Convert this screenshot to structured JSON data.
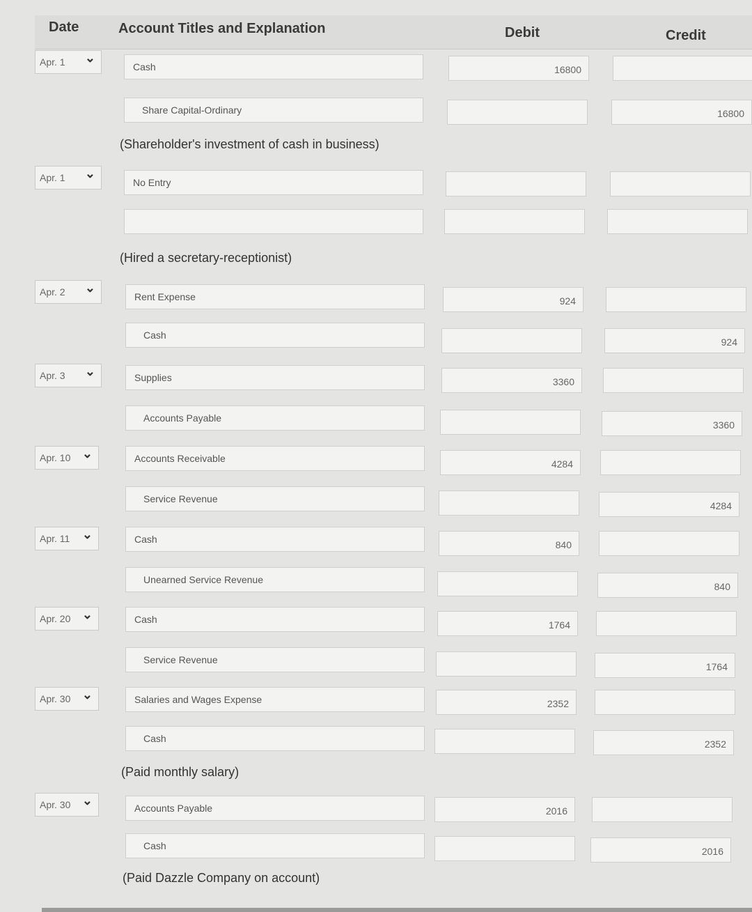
{
  "headers": {
    "date": "Date",
    "account": "Account Titles and Explanation",
    "debit": "Debit",
    "credit": "Credit"
  },
  "entries": [
    {
      "date": "Apr. 1",
      "debit_account": "Cash",
      "credit_account": "Share Capital-Ordinary",
      "debit": "16800",
      "credit": "16800",
      "explanation": "(Shareholder's investment of cash in business)"
    },
    {
      "date": "Apr. 1",
      "debit_account": "No Entry",
      "credit_account": "",
      "debit": "",
      "credit": "",
      "explanation": "(Hired a secretary-receptionist)"
    },
    {
      "date": "Apr. 2",
      "debit_account": "Rent Expense",
      "credit_account": "Cash",
      "debit": "924",
      "credit": "924",
      "explanation": ""
    },
    {
      "date": "Apr. 3",
      "debit_account": "Supplies",
      "credit_account": "Accounts Payable",
      "debit": "3360",
      "credit": "3360",
      "explanation": ""
    },
    {
      "date": "Apr. 10",
      "debit_account": "Accounts Receivable",
      "credit_account": "Service Revenue",
      "debit": "4284",
      "credit": "4284",
      "explanation": ""
    },
    {
      "date": "Apr. 11",
      "debit_account": "Cash",
      "credit_account": "Unearned Service Revenue",
      "debit": "840",
      "credit": "840",
      "explanation": ""
    },
    {
      "date": "Apr. 20",
      "debit_account": "Cash",
      "credit_account": "Service Revenue",
      "debit": "1764",
      "credit": "1764",
      "explanation": ""
    },
    {
      "date": "Apr. 30",
      "debit_account": "Salaries and Wages Expense",
      "credit_account": "Cash",
      "debit": "2352",
      "credit": "2352",
      "explanation": "(Paid monthly salary)"
    },
    {
      "date": "Apr. 30",
      "debit_account": "Accounts Payable",
      "credit_account": "Cash",
      "debit": "2016",
      "credit": "2016",
      "explanation": "(Paid Dazzle Company on account)"
    }
  ],
  "icons": {
    "dropdown": "chevron-down-icon"
  }
}
